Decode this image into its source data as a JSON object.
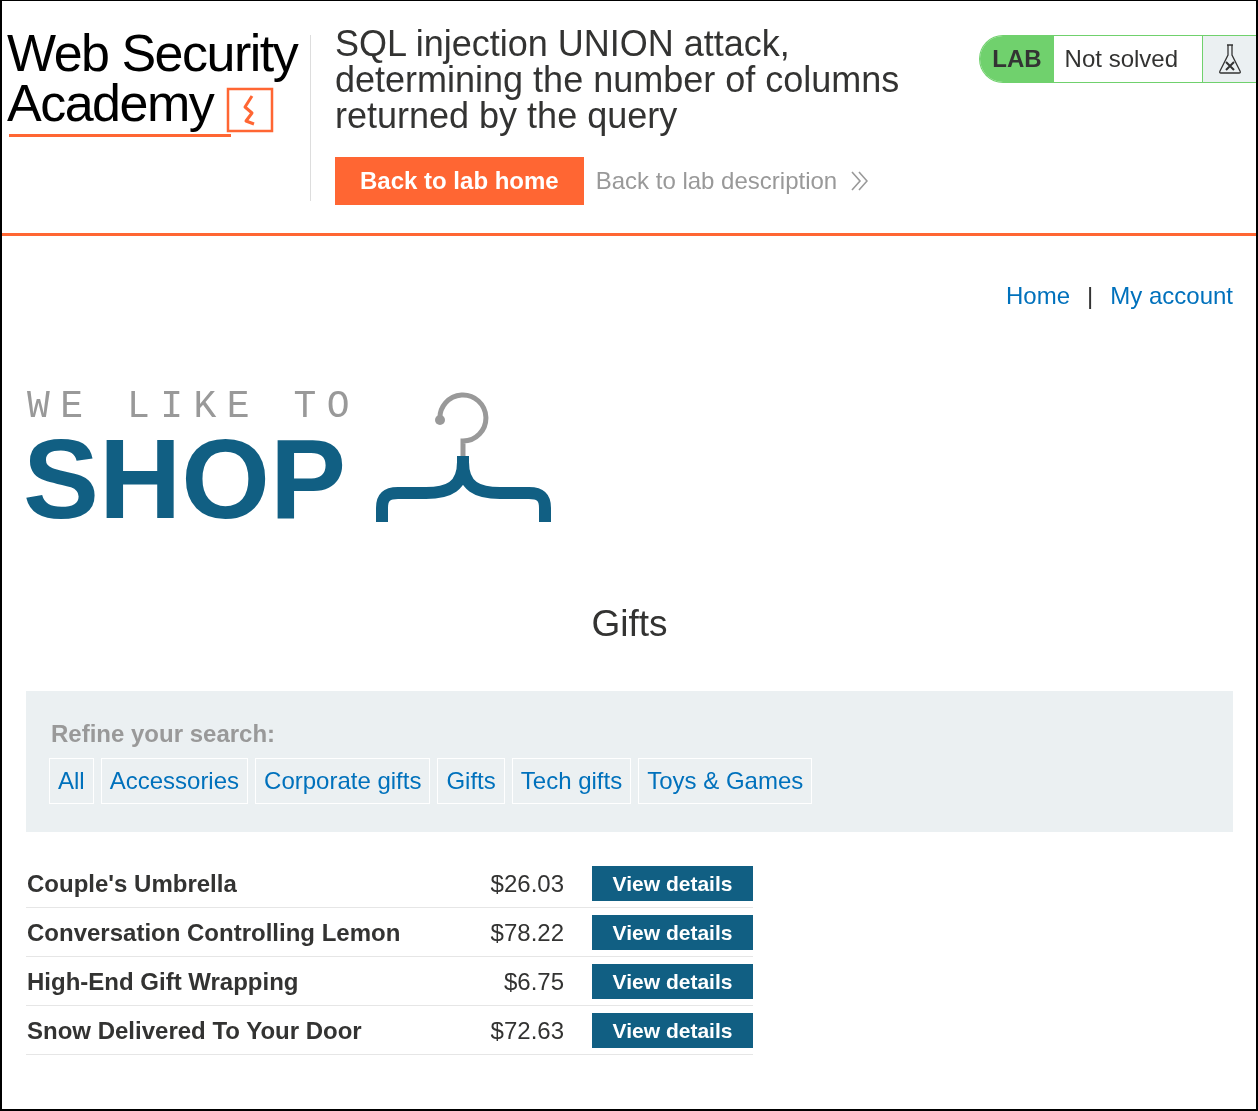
{
  "header": {
    "logo": {
      "line_1": "Web Security",
      "line_2": "Academy"
    },
    "title": "SQL injection UNION attack, determining the number of columns returned by the query",
    "buttons": [
      {
        "kind": "primary",
        "label": "Back to lab home"
      },
      {
        "kind": "link",
        "label": "Back to lab description"
      }
    ],
    "lab_badge": {
      "label": "LAB",
      "status": "Not solved",
      "solved": false
    }
  },
  "nav": {
    "links": [
      "Home",
      "My account"
    ],
    "separator": "|"
  },
  "shop_logo": {
    "tagline": "WE LIKE TO",
    "word": "SHOP"
  },
  "page_title": "Gifts",
  "filters": {
    "heading": "Refine your search:",
    "items": [
      {
        "label": "All",
        "selected": false
      },
      {
        "label": "Accessories",
        "selected": false
      },
      {
        "label": "Corporate gifts",
        "selected": false
      },
      {
        "label": "Gifts",
        "selected": false
      },
      {
        "label": "Tech gifts",
        "selected": false
      },
      {
        "label": "Toys & Games",
        "selected": false
      }
    ]
  },
  "products": [
    {
      "name": "Couple's Umbrella",
      "price": "$26.03",
      "action": "View details"
    },
    {
      "name": "Conversation Controlling Lemon",
      "price": "$78.22",
      "action": "View details"
    },
    {
      "name": "High-End Gift Wrapping",
      "price": "$6.75",
      "action": "View details"
    },
    {
      "name": "Snow Delivered To Your Door",
      "price": "$72.63",
      "action": "View details"
    }
  ]
}
